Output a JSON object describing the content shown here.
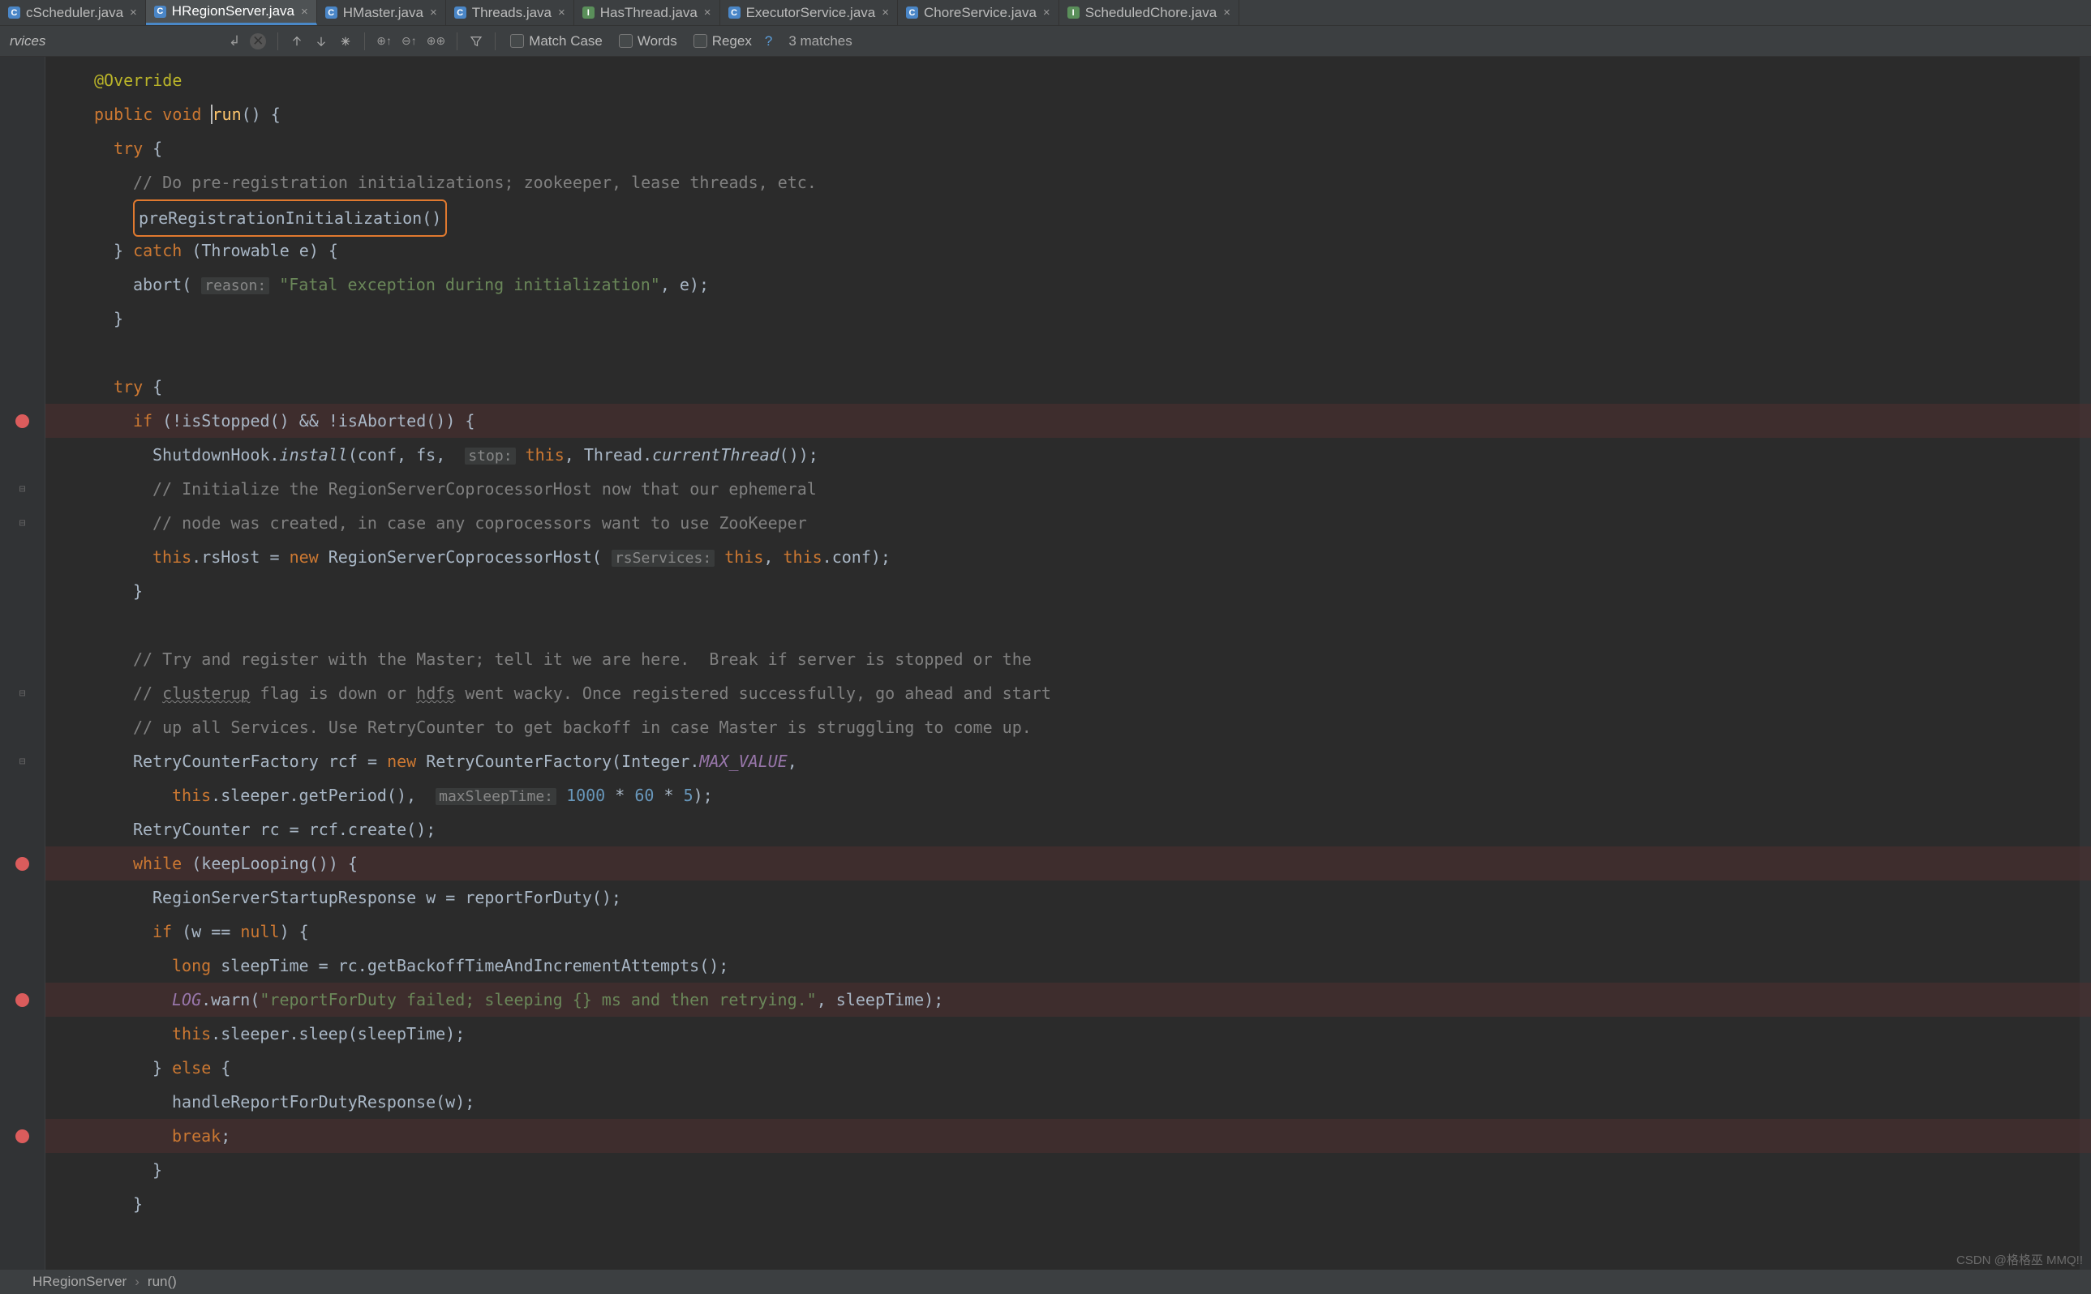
{
  "tabs": [
    {
      "name": "cScheduler.java",
      "icon": "j",
      "active": false
    },
    {
      "name": "HRegionServer.java",
      "icon": "j",
      "active": true
    },
    {
      "name": "HMaster.java",
      "icon": "j",
      "active": false
    },
    {
      "name": "Threads.java",
      "icon": "j",
      "active": false
    },
    {
      "name": "HasThread.java",
      "icon": "i",
      "active": false
    },
    {
      "name": "ExecutorService.java",
      "icon": "j",
      "active": false
    },
    {
      "name": "ChoreService.java",
      "icon": "j",
      "active": false
    },
    {
      "name": "ScheduledChore.java",
      "icon": "i",
      "active": false
    }
  ],
  "findbar": {
    "placeholder": "rvices",
    "options": {
      "match_case": "Match Case",
      "words": "Words",
      "regex": "Regex"
    },
    "matches": "3 matches"
  },
  "crumbs": {
    "a": "HRegionServer",
    "b": "run()"
  },
  "watermark": "CSDN @格格巫 MMQ!!",
  "gutter": [
    {
      "row": 10,
      "type": "dot"
    },
    {
      "row": 12,
      "type": "fold"
    },
    {
      "row": 13,
      "type": "fold"
    },
    {
      "row": 18,
      "type": "fold"
    },
    {
      "row": 20,
      "type": "fold"
    },
    {
      "row": 23,
      "type": "dot"
    },
    {
      "row": 27,
      "type": "dot"
    },
    {
      "row": 31,
      "type": "dot"
    }
  ],
  "highlights": [
    10,
    23,
    27,
    31
  ],
  "code": {
    "l0": {
      "ann": "@Override"
    },
    "l1": {
      "kw1": "public",
      "kw2": "void",
      "mth": "run",
      "rest": "() {"
    },
    "l2": {
      "kw": "try",
      "rest": " {"
    },
    "l3": {
      "cm": "// Do pre-registration initializations; zookeeper, lease threads, etc."
    },
    "l4": {
      "call": "preRegistrationInitialization()"
    },
    "l5": {
      "a": "} ",
      "kw": "catch",
      "b": " (Throwable e) {"
    },
    "l6": {
      "a": "abort( ",
      "hint": "reason:",
      "b": " ",
      "str": "\"Fatal exception during initialization\"",
      "c": ", e);"
    },
    "l7": {
      "a": "}"
    },
    "l9": {
      "kw": "try",
      "rest": " {"
    },
    "l10": {
      "kw": "if",
      "a": " (!isStopped() && !isAborted()) {"
    },
    "l11": {
      "a": "ShutdownHook.",
      "it": "install",
      "b": "(conf, fs,  ",
      "hint": "stop:",
      "c": " ",
      "kw": "this",
      "d": ", Thread.",
      "it2": "currentThread",
      "e": "());"
    },
    "l12": {
      "cm": "// Initialize the RegionServerCoprocessorHost now that our ephemeral"
    },
    "l13": {
      "cm": "// node was created, in case any coprocessors want to use ZooKeeper"
    },
    "l14": {
      "kw1": "this",
      "a": ".rsHost = ",
      "kw2": "new",
      "b": " RegionServerCoprocessorHost( ",
      "hint": "rsServices:",
      "c": " ",
      "kw3": "this",
      "d": ", ",
      "kw4": "this",
      "e": ".conf);"
    },
    "l15": {
      "a": "}"
    },
    "l17": {
      "cm": "// Try and register with the Master; tell it we are here.  Break if server is stopped or the"
    },
    "l18": {
      "a": "// ",
      "w1": "clusterup",
      "b": " flag is down or ",
      "w2": "hdfs",
      "c": " went wacky. Once registered successfully, go ahead and start"
    },
    "l19": {
      "cm": "// up all Services. Use RetryCounter to get backoff in case Master is struggling to come up."
    },
    "l20": {
      "a": "RetryCounterFactory rcf = ",
      "kw": "new",
      "b": " RetryCounterFactory(Integer.",
      "st": "MAX_VALUE",
      "c": ","
    },
    "l21": {
      "kw": "this",
      "a": ".sleeper.getPeriod(),  ",
      "hint": "maxSleepTime:",
      "b": " ",
      "n1": "1000",
      "c": " * ",
      "n2": "60",
      "d": " * ",
      "n3": "5",
      "e": ");"
    },
    "l22": {
      "a": "RetryCounter rc = rcf.create();"
    },
    "l23": {
      "kw": "while",
      "a": " (keepLooping()) {"
    },
    "l24": {
      "a": "RegionServerStartupResponse w = reportForDuty();"
    },
    "l25": {
      "kw": "if",
      "a": " (w == ",
      "kw2": "null",
      "b": ") {"
    },
    "l26": {
      "kw": "long",
      "a": " sleepTime = rc.getBackoffTimeAndIncrementAttempts();"
    },
    "l27": {
      "st": "LOG",
      "a": ".warn(",
      "str": "\"reportForDuty failed; sleeping {} ms and then retrying.\"",
      "b": ", sleepTime);"
    },
    "l28": {
      "kw": "this",
      "a": ".sleeper.sleep(sleepTime);"
    },
    "l29": {
      "a": "} ",
      "kw": "else",
      "b": " {"
    },
    "l30": {
      "a": "handleReportForDutyResponse(w);"
    },
    "l31": {
      "kw": "break",
      "a": ";"
    },
    "l32": {
      "a": "}"
    },
    "l33": {
      "a": "}"
    }
  }
}
